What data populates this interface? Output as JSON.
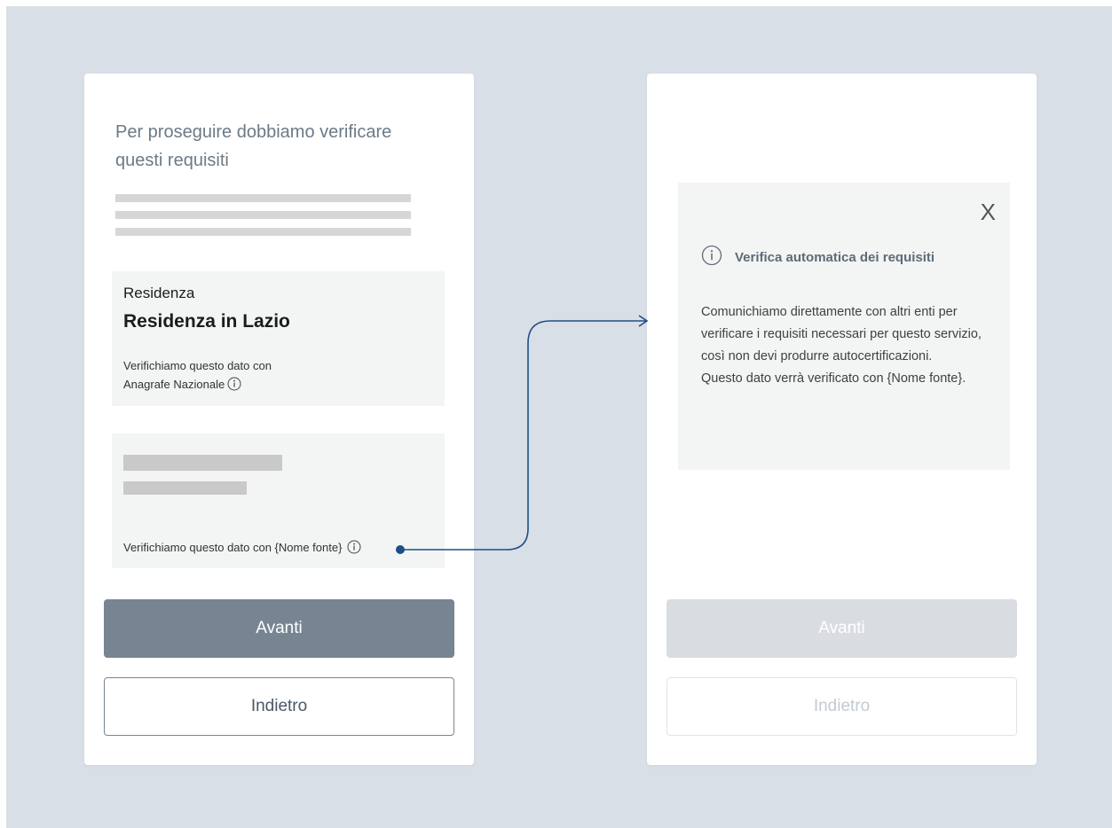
{
  "left_screen": {
    "title": "Per proseguire dobbiamo verificare questi requisiti",
    "residenza_card": {
      "label": "Residenza",
      "value": "Residenza in Lazio",
      "verify_line1": "Verifichiamo questo dato con",
      "verify_line2": "Anagrafe Nazionale"
    },
    "placeholder_card": {
      "verify_text": "Verifichiamo questo dato con {Nome fonte}"
    },
    "primary_button": "Avanti",
    "secondary_button": "Indietro"
  },
  "right_screen": {
    "modal": {
      "close_label": "X",
      "title": "Verifica automatica dei requisiti",
      "body_line1": "Comunichiamo direttamente con altri enti per verificare i requisiti necessari per questo servizio, così non devi produrre autocertificazioni.",
      "body_line2": "Questo dato verrà verificato con {Nome fonte}."
    },
    "primary_button": "Avanti",
    "secondary_button": "Indietro",
    "buttons_state": "disabled"
  },
  "icons": {
    "info": "info-circle-icon",
    "close": "close-icon",
    "connector_arrow": "arrow-right-icon"
  },
  "colors": {
    "background": "#d9dfe6",
    "primary_button": "#778593",
    "connector": "#1f4e85",
    "panel": "#f3f4f4"
  }
}
